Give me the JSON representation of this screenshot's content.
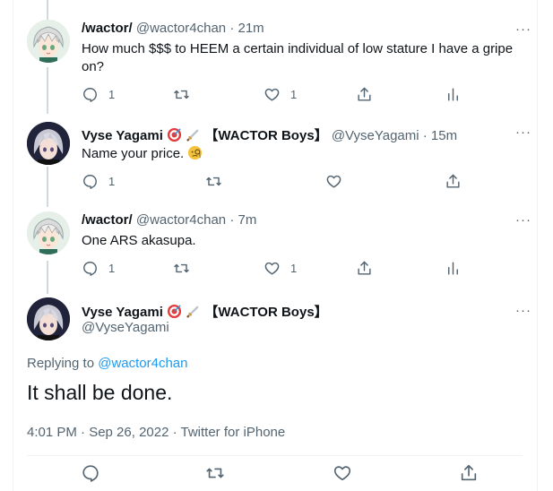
{
  "tweets": [
    {
      "name": "/wactor/",
      "handle": "@wactor4chan",
      "time": "· 21m",
      "text": "How much $$$ to HEEM a certain individual of low stature I have a gripe on?",
      "reply_count": "1",
      "like_count": "1",
      "more": "···"
    },
    {
      "name": "Vyse Yagami",
      "badge": "【WACTOR Boys】",
      "handle": "@VyseYagami",
      "time": "· 15m",
      "text": "Name your price.",
      "reply_count": "1",
      "more": "···"
    },
    {
      "name": "/wactor/",
      "handle": "@wactor4chan",
      "time": "· 7m",
      "text": "One ARS akasupa.",
      "reply_count": "1",
      "like_count": "1",
      "more": "···"
    }
  ],
  "main_tweet": {
    "name": "Vyse Yagami",
    "badge": "【WACTOR Boys】",
    "handle": "@VyseYagami",
    "replying_prefix": "Replying to",
    "replying_to": "@wactor4chan",
    "text": "It shall be done.",
    "meta": "4:01 PM · Sep 26, 2022 · Twitter for iPhone",
    "more": "···"
  },
  "colors": {
    "accent": "#1d9bf0",
    "muted": "#536471",
    "text": "#0f1419",
    "thread_line": "#cfd9de"
  },
  "icons": [
    "reply-icon",
    "retweet-icon",
    "like-icon",
    "share-icon",
    "analytics-icon",
    "target-emoji-icon",
    "sword-emoji-icon",
    "monocle-emoji-icon"
  ]
}
